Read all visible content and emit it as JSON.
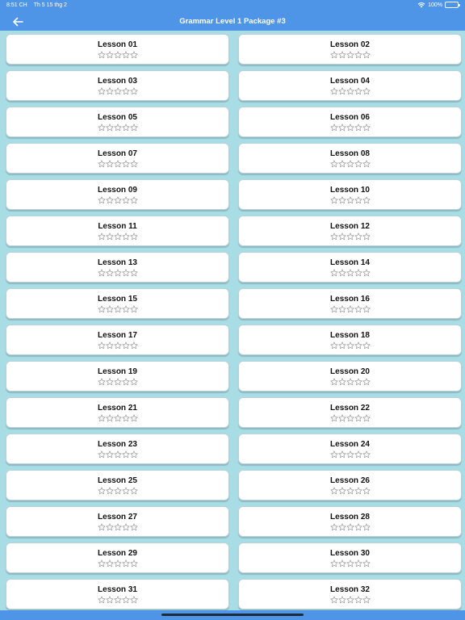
{
  "status": {
    "time": "8:51 CH",
    "date": "Th 5 15 thg 2",
    "battery": "100%"
  },
  "header": {
    "title": "Grammar Level 1 Package #3",
    "back_icon": "arrow-left-icon"
  },
  "colors": {
    "header": "#4e95e8",
    "background": "#a9dde6",
    "card": "#ffffff",
    "star_outline": "#9a9a9a"
  },
  "lessons": [
    {
      "label": "Lesson 01",
      "stars": 0
    },
    {
      "label": "Lesson 02",
      "stars": 0
    },
    {
      "label": "Lesson 03",
      "stars": 0
    },
    {
      "label": "Lesson 04",
      "stars": 0
    },
    {
      "label": "Lesson 05",
      "stars": 0
    },
    {
      "label": "Lesson 06",
      "stars": 0
    },
    {
      "label": "Lesson 07",
      "stars": 0
    },
    {
      "label": "Lesson 08",
      "stars": 0
    },
    {
      "label": "Lesson 09",
      "stars": 0
    },
    {
      "label": "Lesson 10",
      "stars": 0
    },
    {
      "label": "Lesson 11",
      "stars": 0
    },
    {
      "label": "Lesson 12",
      "stars": 0
    },
    {
      "label": "Lesson 13",
      "stars": 0
    },
    {
      "label": "Lesson 14",
      "stars": 0
    },
    {
      "label": "Lesson 15",
      "stars": 0
    },
    {
      "label": "Lesson 16",
      "stars": 0
    },
    {
      "label": "Lesson 17",
      "stars": 0
    },
    {
      "label": "Lesson 18",
      "stars": 0
    },
    {
      "label": "Lesson 19",
      "stars": 0
    },
    {
      "label": "Lesson 20",
      "stars": 0
    },
    {
      "label": "Lesson 21",
      "stars": 0
    },
    {
      "label": "Lesson 22",
      "stars": 0
    },
    {
      "label": "Lesson 23",
      "stars": 0
    },
    {
      "label": "Lesson 24",
      "stars": 0
    },
    {
      "label": "Lesson 25",
      "stars": 0
    },
    {
      "label": "Lesson 26",
      "stars": 0
    },
    {
      "label": "Lesson 27",
      "stars": 0
    },
    {
      "label": "Lesson 28",
      "stars": 0
    },
    {
      "label": "Lesson 29",
      "stars": 0
    },
    {
      "label": "Lesson 30",
      "stars": 0
    },
    {
      "label": "Lesson 31",
      "stars": 0
    },
    {
      "label": "Lesson 32",
      "stars": 0
    }
  ],
  "max_stars": 5
}
